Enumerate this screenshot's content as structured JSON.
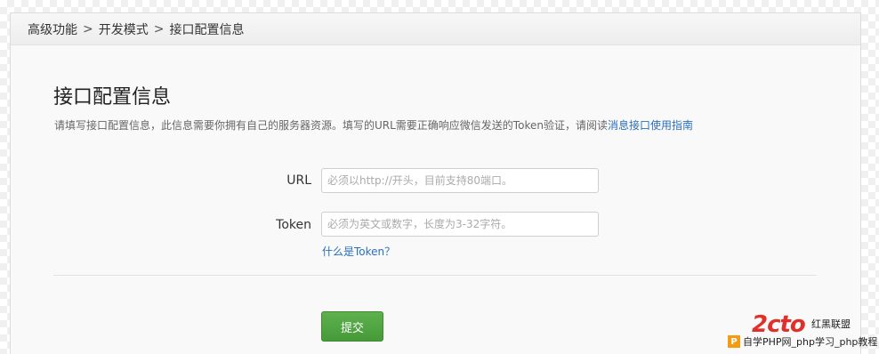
{
  "breadcrumb": {
    "items": [
      "高级功能",
      "开发模式",
      "接口配置信息"
    ],
    "separator": ">"
  },
  "page": {
    "title": "接口配置信息",
    "description": "请填写接口配置信息，此信息需要你拥有自己的服务器资源。填写的URL需要正确响应微信发送的Token验证，请阅读",
    "description_link": "消息接口使用指南"
  },
  "form": {
    "url_label": "URL",
    "url_placeholder": "必须以http://开头，目前支持80端口。",
    "url_value": "",
    "token_label": "Token",
    "token_placeholder": "必须为英文或数字，长度为3-32字符。",
    "token_value": "",
    "token_help": "什么是Token？",
    "submit_label": "提交"
  },
  "watermark": {
    "logo_text": "2cto",
    "tag": "红黑联盟",
    "badge": "P",
    "line": "自学PHP网_php学习_php教程"
  },
  "colors": {
    "link": "#2a6fb8",
    "submit": "#4ea342",
    "watermark_red": "#e0302a"
  }
}
